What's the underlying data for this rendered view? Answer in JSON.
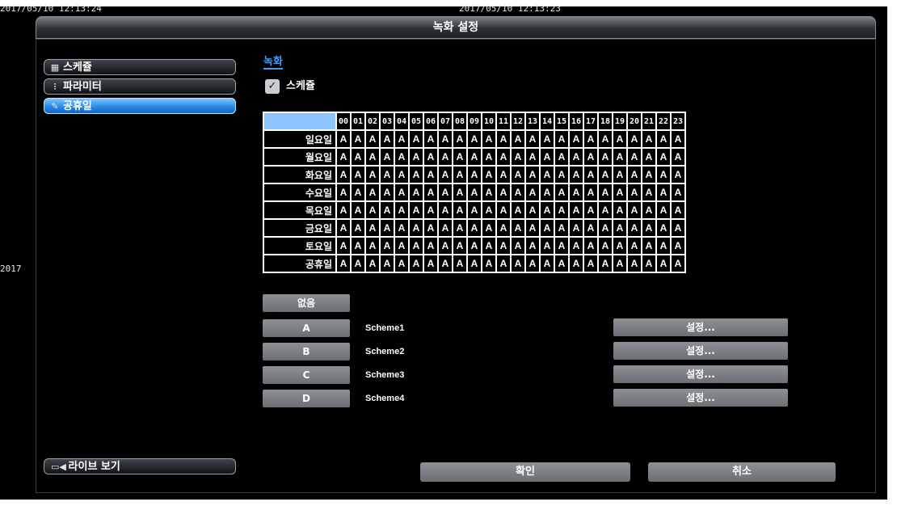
{
  "clock_left": "2017/05/10 12:13:24",
  "clock_center": "2017/05/10 12:13:23",
  "side_year": "2017",
  "window_title": "녹화 설정",
  "sidebar": {
    "items": [
      {
        "label": "스케쥴",
        "icon": "calendar-icon"
      },
      {
        "label": "파라미터",
        "icon": "sliders-icon"
      },
      {
        "label": "공휴일",
        "icon": "holiday-icon",
        "active": true
      }
    ]
  },
  "section_tab": "녹화",
  "schedule_checkbox": {
    "label": "스케쥴",
    "checked": true,
    "mark": "✓"
  },
  "grid": {
    "hours": [
      "00",
      "01",
      "02",
      "03",
      "04",
      "05",
      "06",
      "07",
      "08",
      "09",
      "10",
      "11",
      "12",
      "13",
      "14",
      "15",
      "16",
      "17",
      "18",
      "19",
      "20",
      "21",
      "22",
      "23"
    ],
    "days": [
      "일요일",
      "월요일",
      "화요일",
      "수요일",
      "목요일",
      "금요일",
      "토요일",
      "공휴일"
    ],
    "cell_value": "A"
  },
  "none_button": "없음",
  "schemes": [
    {
      "key": "A",
      "name": "Scheme1",
      "setting": "설정..."
    },
    {
      "key": "B",
      "name": "Scheme2",
      "setting": "설정..."
    },
    {
      "key": "C",
      "name": "Scheme3",
      "setting": "설정..."
    },
    {
      "key": "D",
      "name": "Scheme4",
      "setting": "설정..."
    }
  ],
  "live_view_button": "라이브 보기",
  "confirm_button": "확인",
  "cancel_button": "취소",
  "colors": {
    "accent": "#3aa0ff",
    "active_button": "#2b8ae6",
    "grid_header": "#8ec5ff"
  }
}
